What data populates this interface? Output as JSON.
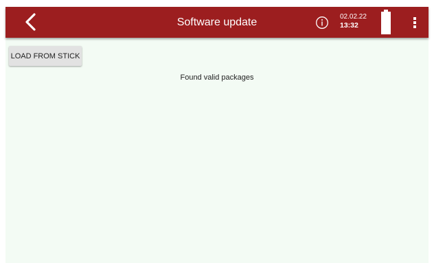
{
  "header": {
    "title": "Software update",
    "back_icon": "chevron-left-icon",
    "info_icon": "info-icon",
    "date": "02.02.22",
    "time": "13:32",
    "battery_icon": "battery-full-icon",
    "menu_icon": "more-vertical-icon"
  },
  "main": {
    "load_button_label": "LOAD FROM STICK",
    "status_text": "Found valid packages"
  },
  "colors": {
    "appbar": "#9c1e1f",
    "background": "#f3fbf4",
    "button": "#e2e2e2"
  }
}
